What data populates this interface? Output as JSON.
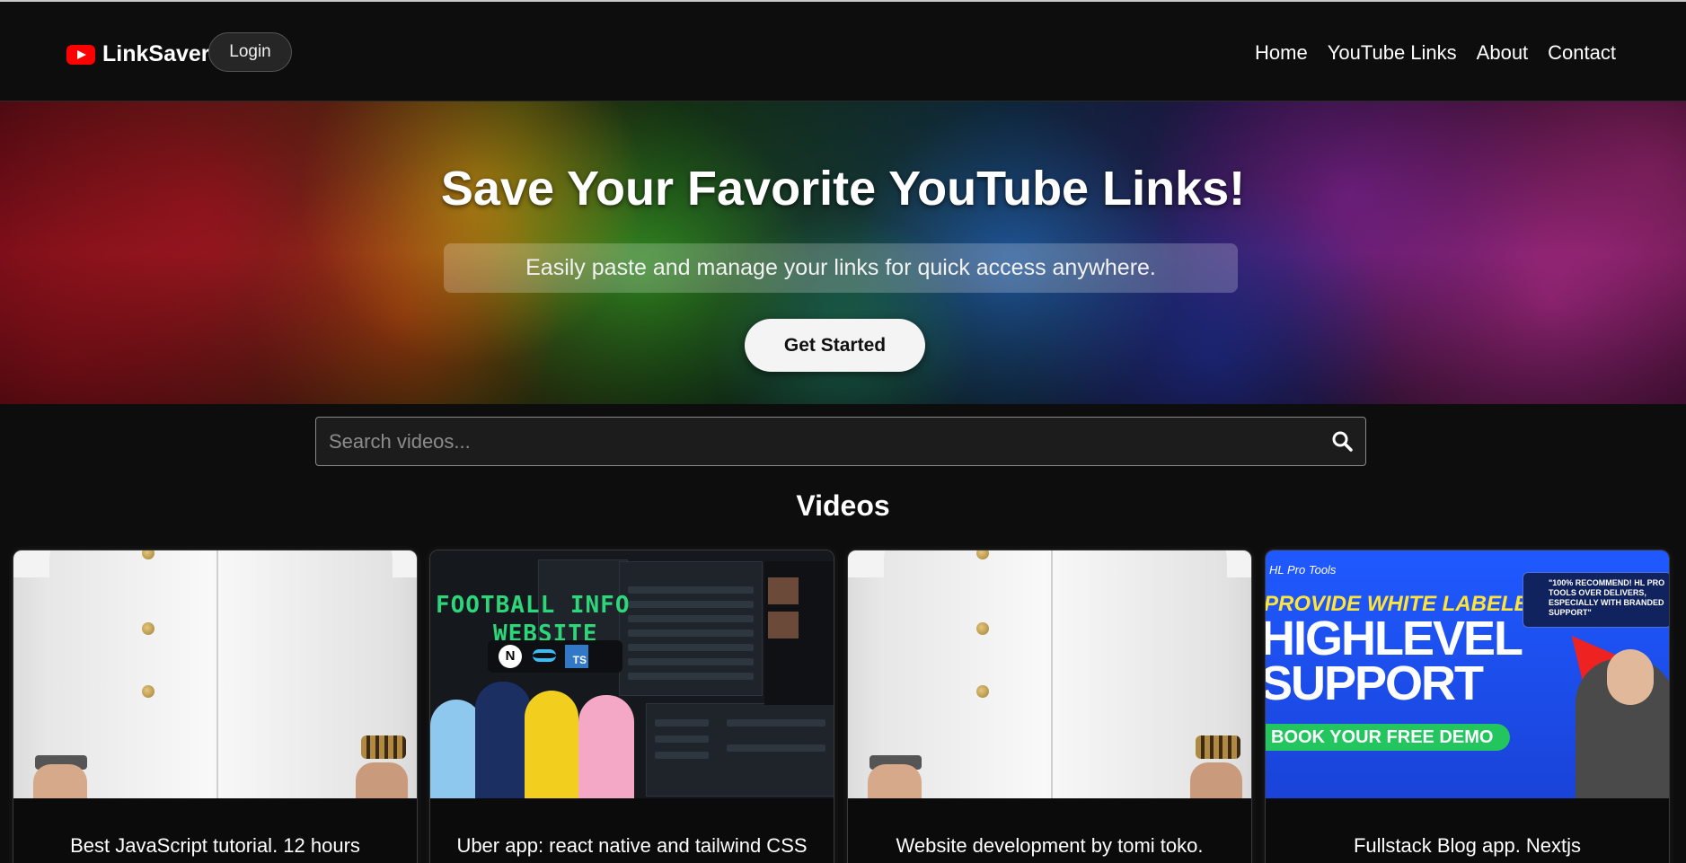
{
  "nav": {
    "brand": "LinkSaver",
    "login_label": "Login",
    "links": [
      "Home",
      "YouTube Links",
      "About",
      "Contact"
    ]
  },
  "hero": {
    "title": "Save Your Favorite YouTube Links!",
    "subtitle": "Easily paste and manage your links for quick access anywhere.",
    "cta_label": "Get Started"
  },
  "search": {
    "placeholder": "Search videos..."
  },
  "videos": {
    "section_title": "Videos",
    "cards": [
      {
        "title": "Best JavaScript tutorial. 12 hours",
        "thumbnail": "white-suit"
      },
      {
        "title": "Uber app: react native and tailwind CSS",
        "thumbnail": "football-info-website"
      },
      {
        "title": "Website development by tomi toko.",
        "thumbnail": "white-suit"
      },
      {
        "title": "Fullstack Blog app. Nextjs",
        "thumbnail": "highlevel-support"
      }
    ]
  },
  "thumb_text": {
    "football_line1": "FOOTBALL INFO",
    "football_line2": "WEBSITE",
    "football_next": "N",
    "football_ts": "TS",
    "hl_brand": "HL Pro Tools",
    "hl_line1": "PROVIDE WHITE LABELED",
    "hl_line2": "HIGHLEVEL",
    "hl_line3": "SUPPORT",
    "hl_demo": "BOOK YOUR FREE DEMO",
    "hl_quote": "\"100% RECOMMEND! HL PRO TOOLS OVER DELIVERS, ESPECIALLY WITH BRANDED SUPPORT\""
  },
  "colors": {
    "background": "#0d0d0d",
    "youtube_red": "#ff0000",
    "cta_bg": "#f4f4f4"
  }
}
